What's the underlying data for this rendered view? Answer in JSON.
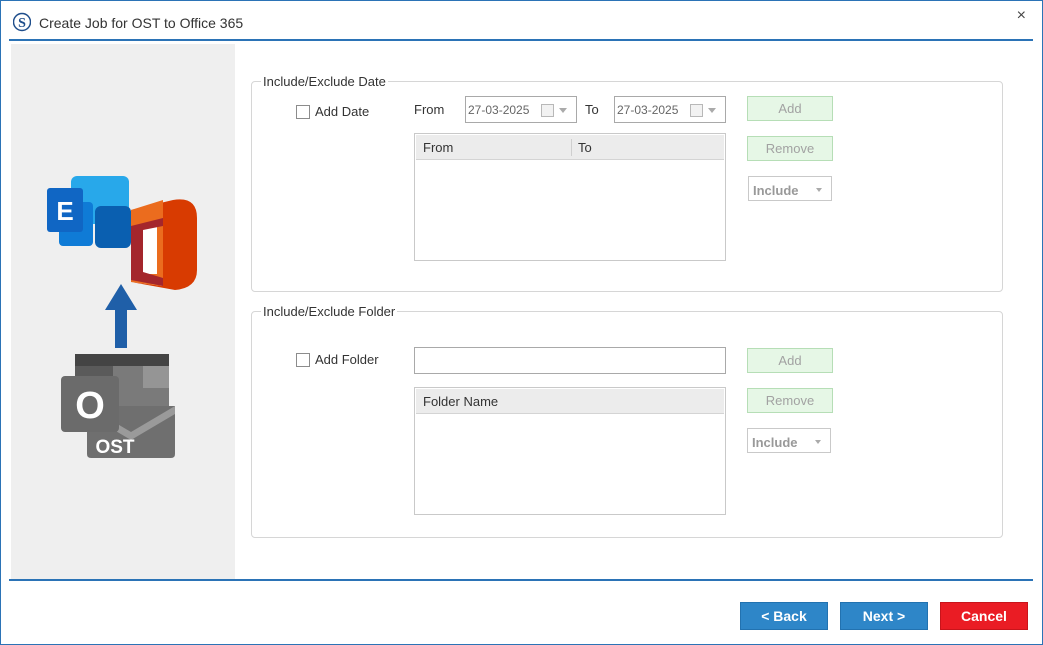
{
  "window": {
    "title": "Create Job for OST to Office 365",
    "close_label": "×"
  },
  "graphic": {
    "exchange_letter": "E",
    "outlook_letter": "O",
    "ost_label": "OST"
  },
  "date_group": {
    "title": "Include/Exclude Date",
    "add_date_label": "Add Date",
    "from_label": "From",
    "from_value": "27-03-2025",
    "to_label": "To",
    "to_value": "27-03-2025",
    "add_button": "Add",
    "remove_button": "Remove",
    "mode": "Include",
    "columns": [
      "From",
      "To"
    ]
  },
  "folder_group": {
    "title": "Include/Exclude Folder",
    "add_folder_label": "Add Folder",
    "folder_value": "",
    "add_button": "Add",
    "remove_button": "Remove",
    "mode": "Include",
    "columns": [
      "Folder Name"
    ]
  },
  "footer": {
    "back": "< Back",
    "next": "Next >",
    "cancel": "Cancel"
  },
  "icons": [
    "app-logo-icon",
    "close-icon",
    "exchange-icon",
    "office-icon",
    "up-arrow-icon",
    "outlook-ost-icon",
    "calendar-icon",
    "chevron-down-icon"
  ],
  "colors": {
    "accent": "#2b73b6",
    "primary_button": "#2e86c8",
    "cancel_button": "#ea1c24",
    "disabled_button_bg": "#e6f7e6"
  }
}
